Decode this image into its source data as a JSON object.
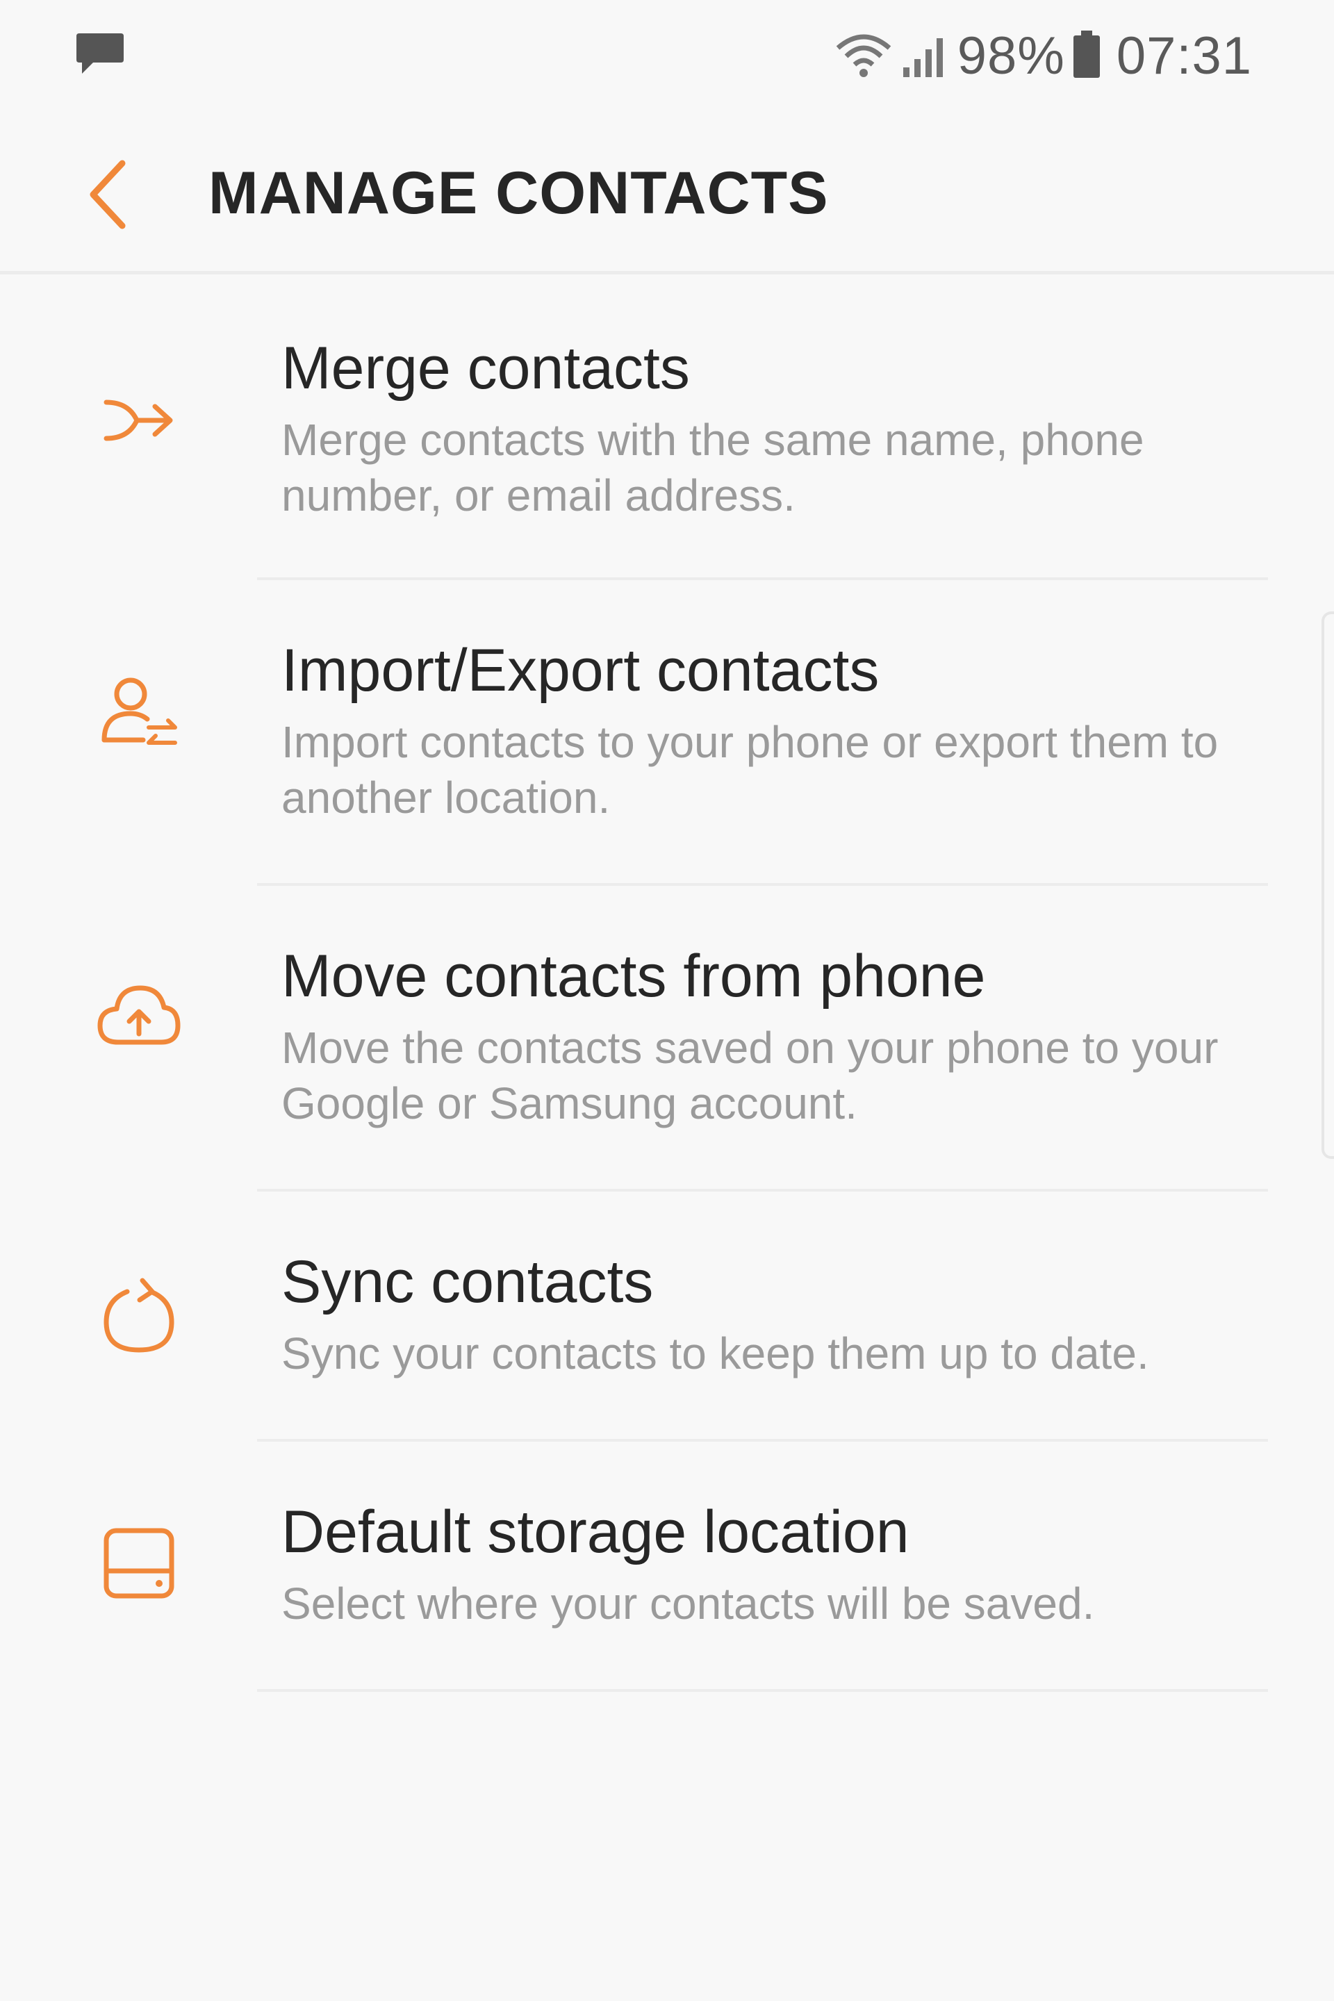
{
  "status_bar": {
    "battery": "98%",
    "time": "07:31",
    "icons": [
      "message-icon",
      "wifi-icon",
      "signal-icon",
      "battery-icon"
    ]
  },
  "header": {
    "title": "MANAGE CONTACTS",
    "back_icon": "chevron-left-icon"
  },
  "items": [
    {
      "title": "Merge contacts",
      "description": "Merge contacts with the same name, phone number, or email address.",
      "icon": "merge-icon"
    },
    {
      "title": "Import/Export contacts",
      "description": "Import contacts to your phone or export them to another location.",
      "icon": "import-export-icon"
    },
    {
      "title": "Move contacts from phone",
      "description": "Move the contacts saved on your phone to your Google or Samsung account.",
      "icon": "cloud-upload-icon"
    },
    {
      "title": "Sync contacts",
      "description": "Sync your contacts to keep them up to date.",
      "icon": "sync-icon"
    },
    {
      "title": "Default storage location",
      "description": "Select where your contacts will be saved.",
      "icon": "storage-icon"
    }
  ],
  "colors": {
    "accent": "#f0883a",
    "title_text": "#262626",
    "secondary_text": "#9a9a9a",
    "background": "#f8f8f8"
  }
}
